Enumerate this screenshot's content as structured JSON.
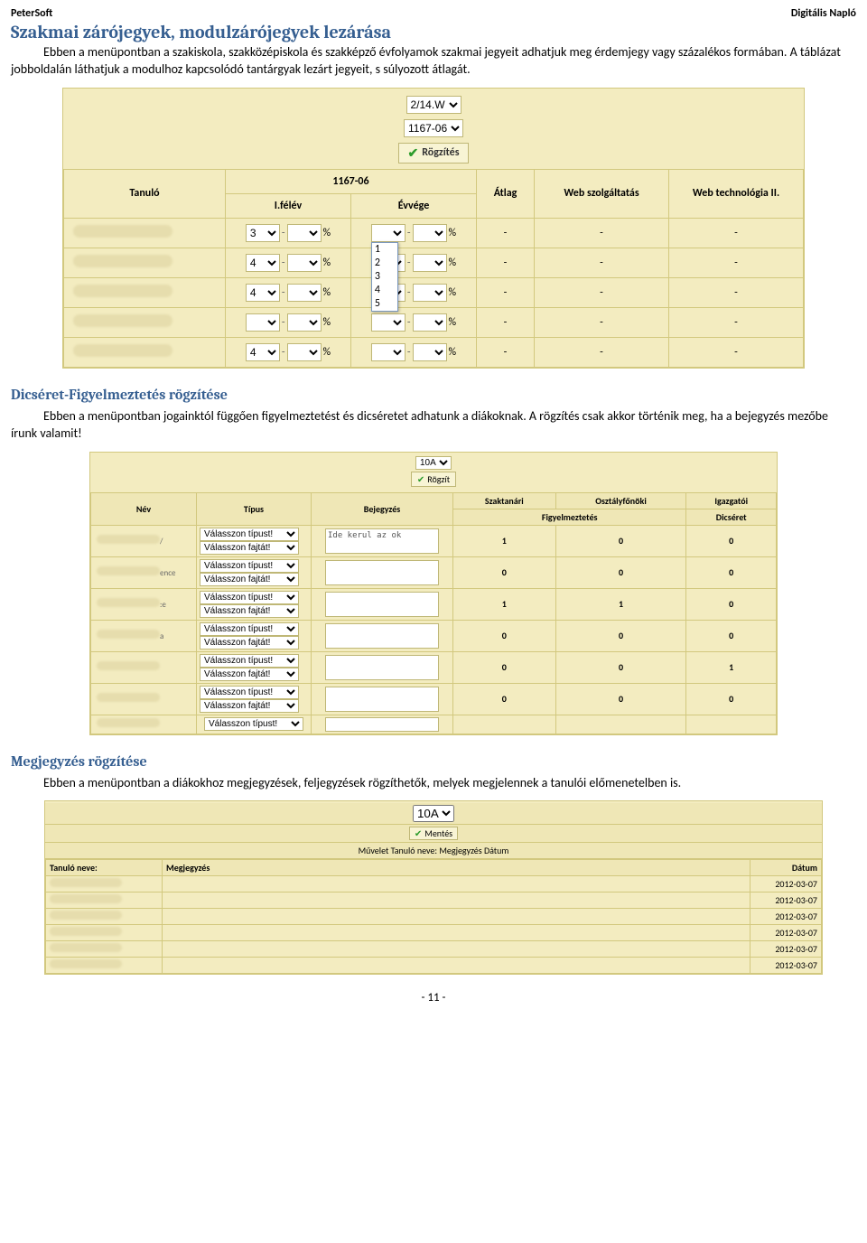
{
  "header": {
    "left": "PeterSoft",
    "right": "Digitális Napló"
  },
  "h1": "Szakmai zárójegyek, modulzárójegyek lezárása",
  "para1": "Ebben a menüpontban a szakiskola, szakközépiskola és szakképző évfolyamok szakmai jegyeit adhatjuk meg érdemjegy vagy százalékos formában. A táblázat jobboldalán láthatjuk a modulhoz kapcsolódó tantárgyak lezárt jegyeit, s súlyozott átlagát.",
  "shot1": {
    "class_select": "2/14.W",
    "module_select": "1167-06",
    "save_btn": "Rögzítés",
    "th_tanulo": "Tanuló",
    "th_module": "1167-06",
    "th_felev": "I.félév",
    "th_evvege": "Évvége",
    "th_atlag": "Átlag",
    "th_webszolg": "Web szolgáltatás",
    "th_webtech": "Web technológia II.",
    "dash": "-",
    "percent": "%",
    "dropdown_items": [
      "",
      "1",
      "2",
      "3",
      "4",
      "5"
    ],
    "row_grades": [
      "3",
      "4",
      "4",
      "",
      "4"
    ]
  },
  "h2": "Dicséret-Figyelmeztetés rögzítése",
  "para2": "Ebben a menüpontban jogainktól függően figyelmeztetést és dicséretet adhatunk a diákoknak. A rögzítés csak akkor történik meg, ha a bejegyzés mezőbe írunk valamit!",
  "shot2": {
    "class_select": "10A",
    "save_btn": "Rögzít",
    "th_nev": "Név",
    "th_tipus": "Típus",
    "th_bejegyzes": "Bejegyzés",
    "th_szaktanari": "Szaktanári",
    "th_osztalyfonoki": "Osztályfőnöki",
    "th_igazgatoi": "Igazgatói",
    "th_figy": "Figyelmeztetés",
    "th_dics": "Dicséret",
    "type_placeholder": "Válasszon típust!",
    "kind_placeholder": "Válasszon fajtát!",
    "entry_text": "Ide kerul az ok",
    "rows": [
      {
        "name": "/",
        "a": 1,
        "b": 0,
        "c": 0,
        "filled": true
      },
      {
        "name": "ence",
        "a": 0,
        "b": 0,
        "c": 0
      },
      {
        "name": ":e",
        "a": 1,
        "b": 1,
        "c": 0
      },
      {
        "name": "a",
        "a": 0,
        "b": 0,
        "c": 0
      },
      {
        "name": "",
        "a": 0,
        "b": 0,
        "c": 1
      },
      {
        "name": "",
        "a": 0,
        "b": 0,
        "c": 0
      }
    ],
    "lastrow_type": "Válasszon típust!"
  },
  "h3": "Megjegyzés rögzítése",
  "para3": "Ebben a menüpontban a diákokhoz megjegyzések, feljegyzések rögzíthetők, melyek megjelennek a tanulói előmenetelben is.",
  "shot3": {
    "class_select": "10A",
    "ment_btn": "Mentés",
    "ops_label": "Művelet Tanuló neve: Megjegyzés Dátum",
    "th_tanulo": "Tanuló neve:",
    "th_megj": "Megjegyzés",
    "th_datum": "Dátum",
    "dates": [
      "2012-03-07",
      "2012-03-07",
      "2012-03-07",
      "2012-03-07",
      "2012-03-07",
      "2012-03-07"
    ]
  },
  "page_num": "- 11 -"
}
